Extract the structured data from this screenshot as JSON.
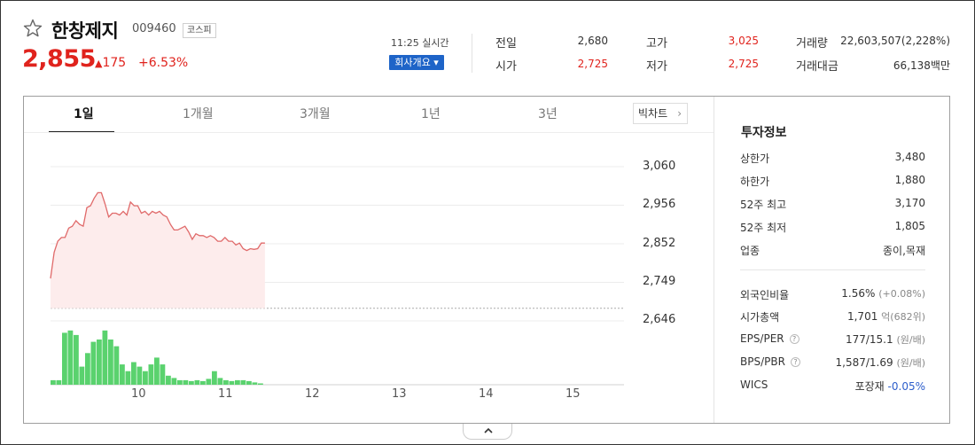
{
  "stock": {
    "name": "한창제지",
    "code": "009460",
    "market": "코스피",
    "price": "2,855",
    "change_symbol": "▲",
    "change": "175",
    "rate": "+6.53%"
  },
  "header": {
    "realtime": "11:25 실시간",
    "company_button": "회사개요 ▾"
  },
  "quote": {
    "prev_label": "전일",
    "prev": "2,680",
    "high_label": "고가",
    "high": "3,025",
    "volume_label": "거래량",
    "volume": "22,603,507(2,228%)",
    "open_label": "시가",
    "open": "2,725",
    "low_label": "저가",
    "low": "2,725",
    "amount_label": "거래대금",
    "amount": "66,138백만"
  },
  "tabs": [
    "1일",
    "1개월",
    "3개월",
    "1년",
    "3년"
  ],
  "big_chart_label": "빅차트",
  "chart_data": {
    "type": "line",
    "title": "",
    "y_ticks": [
      "3,060",
      "2,956",
      "2,852",
      "2,749",
      "2,646"
    ],
    "x_ticks": [
      "10",
      "11",
      "12",
      "13",
      "14",
      "15"
    ],
    "ylim": [
      2646,
      3060
    ],
    "prev_close": 2680,
    "series": [
      {
        "price": [
          2760,
          2830,
          2860,
          2870,
          2870,
          2895,
          2900,
          2915,
          2905,
          2900,
          2950,
          2955,
          2975,
          2990,
          2990,
          2960,
          2925,
          2935,
          2935,
          2930,
          2940,
          2930,
          2965,
          2955,
          2955,
          2935,
          2940,
          2930,
          2940,
          2935,
          2940,
          2930,
          2925,
          2905,
          2890,
          2890,
          2895,
          2900,
          2885,
          2865,
          2880,
          2875,
          2875,
          2870,
          2875,
          2870,
          2860,
          2860,
          2870,
          2860,
          2860,
          2850,
          2855,
          2840,
          2835,
          2840,
          2838,
          2840,
          2855,
          2855
        ],
        "volume": [
          1.0,
          1.0,
          11.5,
          12.0,
          11.0,
          4.0,
          7.0,
          9.5,
          10.0,
          12.0,
          10.0,
          8.5,
          4.5,
          3.0,
          5.0,
          4.0,
          3.0,
          4.5,
          6.0,
          4.5,
          2.0,
          1.5,
          1.0,
          1.0,
          0.8,
          1.0,
          0.8,
          1.3,
          3.0,
          1.5,
          1.0,
          0.8,
          1.0,
          1.0,
          0.8,
          0.5,
          0.3
        ]
      }
    ]
  },
  "invest": {
    "title": "투자정보",
    "rows1": [
      {
        "label": "상한가",
        "value": "3,480"
      },
      {
        "label": "하한가",
        "value": "1,880"
      },
      {
        "label": "52주 최고",
        "value": "3,170"
      },
      {
        "label": "52주 최저",
        "value": "1,805"
      },
      {
        "label": "업종",
        "value": "종이,목재"
      }
    ],
    "foreign_label": "외국인비율",
    "foreign_value": "1.56%",
    "foreign_sub": "(+0.08%)",
    "mcap_label": "시가총액",
    "mcap_value": "1,701",
    "mcap_unit": "억",
    "mcap_sub": "(682위)",
    "eps_label": "EPS/PER",
    "eps_value": "177/15.1",
    "eps_unit": "(원/배)",
    "bps_label": "BPS/PBR",
    "bps_value": "1,587/1.69",
    "bps_unit": "(원/배)",
    "wics_label": "WICS",
    "wics_value": "포장재",
    "wics_change": "-0.05%"
  },
  "colors": {
    "up": "#e0231d",
    "down": "#2d5ecb",
    "volume_bar": "#5ad26e",
    "line": "#e06a6a"
  }
}
